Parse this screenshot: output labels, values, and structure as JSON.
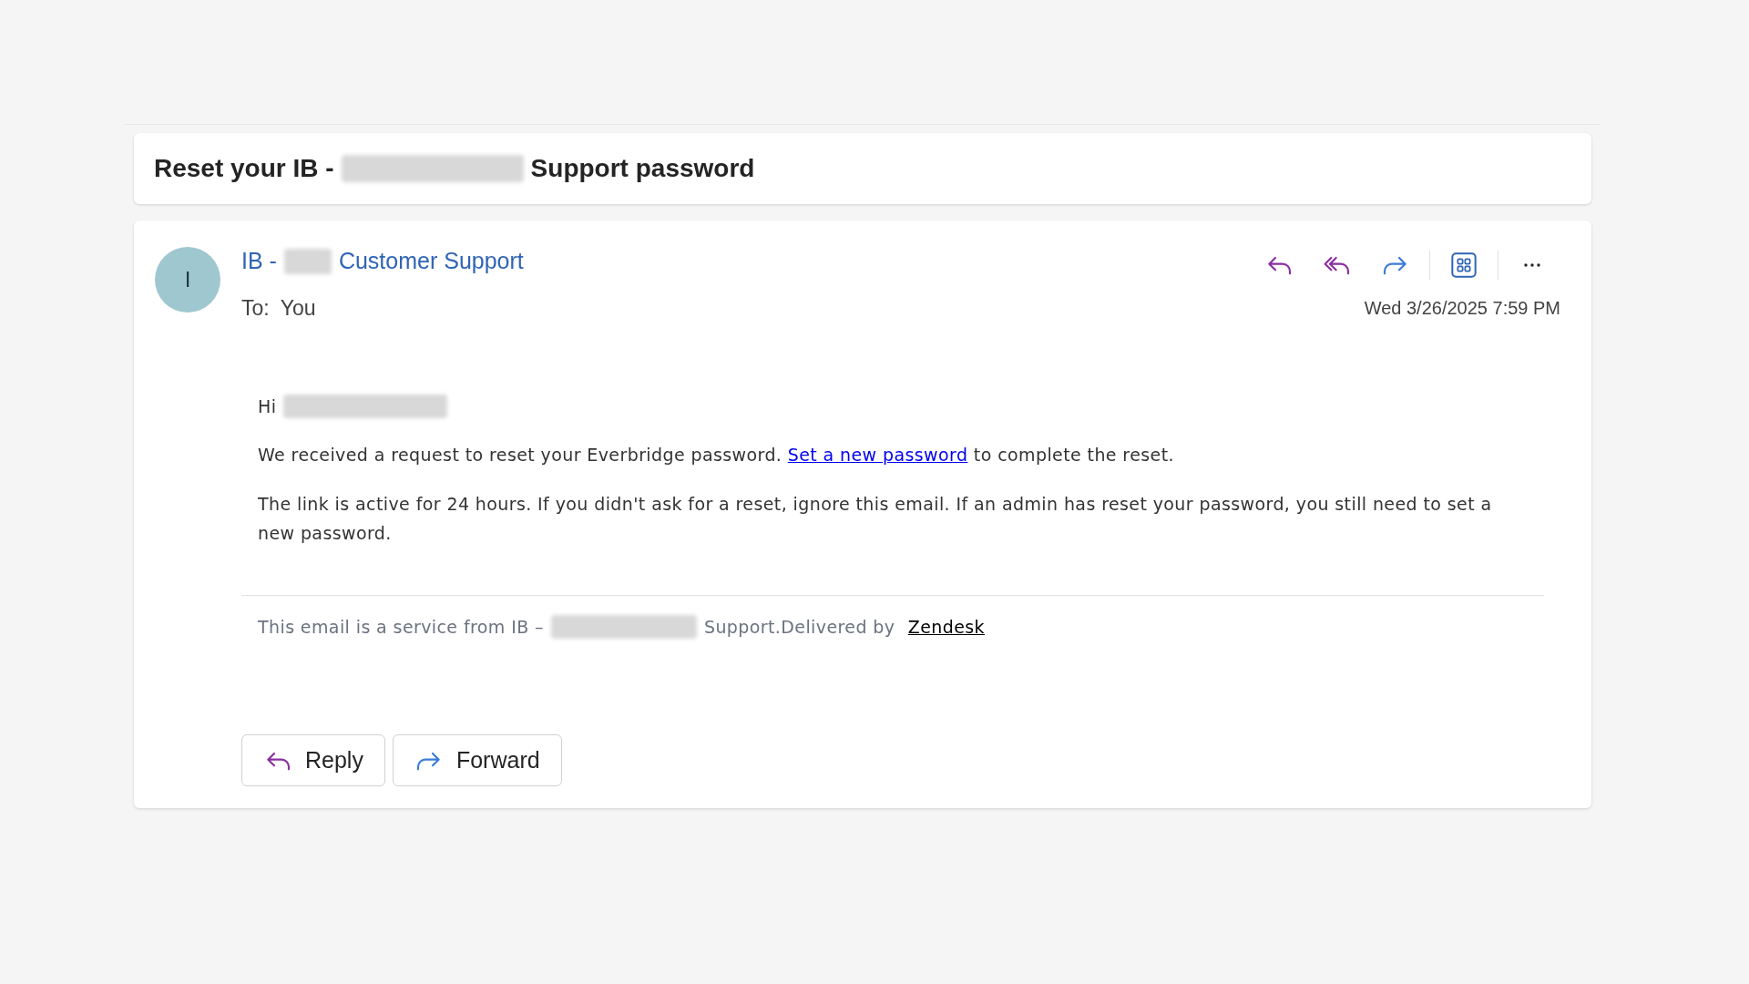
{
  "subject": [
    {
      "kind": "text",
      "text": "Reset your IB -"
    },
    {
      "kind": "redacted"
    },
    {
      "kind": "text",
      "text": "Support password"
    }
  ],
  "message": {
    "avatar": "I",
    "sender": [
      {
        "kind": "text",
        "text": "IB -"
      },
      {
        "kind": "redacted"
      },
      {
        "kind": "text",
        "text": "Customer Support"
      }
    ],
    "to_label": "To:",
    "to": "You",
    "date": "Wed 3/26/2025 7:59 PM",
    "toolbar": [
      {
        "kind": "reply"
      },
      {
        "kind": "reply_all"
      },
      {
        "kind": "forward"
      },
      {
        "kind": "divider"
      },
      {
        "kind": "apps"
      },
      {
        "kind": "divider"
      },
      {
        "kind": "more"
      }
    ],
    "greeting": [
      {
        "kind": "text",
        "text": "Hi"
      },
      {
        "kind": "redacted"
      }
    ],
    "paragraphs": [
      [
        {
          "kind": "text",
          "text": "We received a request to reset your Everbridge password. "
        },
        {
          "kind": "link",
          "text": "Set a new password"
        },
        {
          "kind": "text",
          "text": " to complete the reset."
        }
      ],
      [
        {
          "kind": "text",
          "text": "The link is active for 24 hours. If you didn't ask for a reset, ignore this email. If an admin has reset your password, you still need to set a new password."
        }
      ]
    ],
    "footer": [
      {
        "kind": "text",
        "text": "This email is a service from IB –"
      },
      {
        "kind": "redacted"
      },
      {
        "kind": "text",
        "text": "Support.Delivered by "
      },
      {
        "kind": "link",
        "text": "Zendesk"
      }
    ],
    "buttons": [
      {
        "kind": "reply",
        "label": "Reply"
      },
      {
        "kind": "forward",
        "label": "Forward"
      }
    ]
  }
}
